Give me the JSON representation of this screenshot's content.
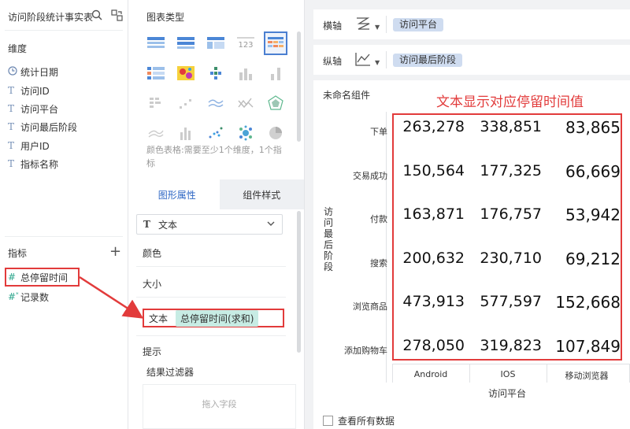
{
  "left_panel": {
    "dataset_title": "访问阶段统计事实表",
    "dimension_label": "维度",
    "dimensions": [
      {
        "icon": "clock-icon",
        "label": "统计日期"
      },
      {
        "icon": "text-type-icon",
        "label": "访问ID"
      },
      {
        "icon": "text-type-icon",
        "label": "访问平台"
      },
      {
        "icon": "text-type-icon",
        "label": "访问最后阶段"
      },
      {
        "icon": "text-type-icon",
        "label": "用户ID"
      },
      {
        "icon": "text-type-icon",
        "label": "指标名称"
      }
    ],
    "measure_label": "指标",
    "measures": [
      {
        "icon": "number-icon",
        "label": "总停留时间"
      },
      {
        "icon": "number-star-icon",
        "label": "记录数"
      }
    ]
  },
  "middle_panel": {
    "chart_type_title": "图表类型",
    "chart_hint": "颜色表格:需要至少1个维度，1个指标",
    "tabs": {
      "active": "图形属性",
      "inactive": "组件样式"
    },
    "mark_type": "文本",
    "props": {
      "color": "颜色",
      "size": "大小",
      "text": "文本",
      "tooltip": "提示"
    },
    "text_field_chip": "总停留时间(求和)",
    "filter_title": "结果过滤器",
    "drop_hint": "拖入字段"
  },
  "axes": {
    "x": {
      "label": "横轴",
      "field": "访问平台"
    },
    "y": {
      "label": "纵轴",
      "field": "访问最后阶段"
    }
  },
  "canvas": {
    "component_name": "未命名组件",
    "annotation": "文本显示对应停留时间值",
    "view_all": "查看所有数据"
  },
  "chart_data": {
    "type": "table",
    "xlabel": "访问平台",
    "ylabel": "访问最后阶段",
    "columns": [
      "Android",
      "IOS",
      "移动浏览器"
    ],
    "rows": [
      "下单",
      "交易成功",
      "付款",
      "搜索",
      "浏览商品",
      "添加购物车"
    ],
    "values": [
      [
        "263,278",
        "338,851",
        "83,865"
      ],
      [
        "150,564",
        "177,325",
        "66,669"
      ],
      [
        "163,871",
        "176,757",
        "53,942"
      ],
      [
        "200,632",
        "230,710",
        "69,212"
      ],
      [
        "473,913",
        "577,597",
        "152,668"
      ],
      [
        "278,050",
        "319,823",
        "107,849"
      ]
    ]
  },
  "colors": {
    "highlight": "#e23b3b",
    "chip_teal": "#c7ece4",
    "chip_blue": "#cfdcf0",
    "accent": "#2d66c4"
  }
}
